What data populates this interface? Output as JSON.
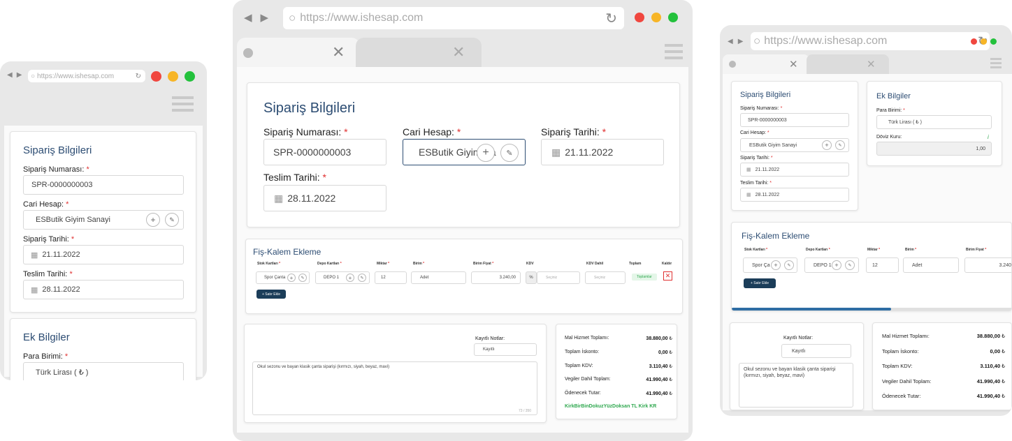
{
  "browser": {
    "url_full": "https://www.ishesap.com",
    "url_small": "https://www.ishesap.com",
    "close": "✕"
  },
  "siparis": {
    "title": "Sipariş Bilgileri",
    "no_label": "Sipariş Numarası:",
    "no_value": "SPR-0000000003",
    "cari_label": "Cari Hesap:",
    "cari_value_full": "ESButik Giyim Sanayi",
    "cari_value_trunc": "ESButik Giyim Sa",
    "tarih_label": "Sipariş Tarihi:",
    "tarih_value": "21.11.2022",
    "teslim_label": "Teslim Tarihi:",
    "teslim_value": "28.11.2022",
    "req": "*"
  },
  "ek": {
    "title": "Ek Bilgiler",
    "para_label": "Para Birimi:",
    "para_value": "Türk Lirası ( ₺ )",
    "doviz_label": "Döviz Kuru:",
    "doviz_value": "1,00",
    "info": "i"
  },
  "fis": {
    "title": "Fiş-Kalem Ekleme",
    "cols": {
      "stok": "Stok Kartları",
      "depo": "Depo Kartları",
      "miktar": "Miktar",
      "birim": "Birim",
      "fiyat": "Birim Fiyat",
      "kdv": "KDV",
      "kdvdahil": "KDV Dahil",
      "toplam": "Toplam",
      "kaldir": "Kaldır"
    },
    "row": {
      "stok": "Spor Çanta",
      "stok_short": "Spor Ça",
      "depo": "DEPO 1",
      "miktar": "12",
      "birim": "Adet",
      "fiyat": "3.240,00",
      "fiyat_short": "3.240",
      "kdv_pct": "%",
      "kdv_ph": "Seçiniz",
      "kdvdahil_ph": "Seçiniz",
      "toplam_badge": "Toplamlar"
    },
    "add_btn": "+ Satır Ekle"
  },
  "notes": {
    "label": "Kayıtlı Notlar:",
    "select": "Kayıtlı",
    "text": "Okul sezonu ve bayan klasik çanta siparişi (kırmızı, siyah, beyaz, mavi)",
    "counter": "73 / 350"
  },
  "summary": {
    "mal_label": "Mal Hizmet Toplamı:",
    "mal": "38.880,00",
    "isk_label": "Toplam İskonto:",
    "isk": "0,00",
    "kdv_label": "Toplam KDV:",
    "kdv": "3.110,40",
    "vdt_label": "Vegiler Dahil Toplam:",
    "vdt": "41.990,40",
    "odn_label": "Ödenecek Tutar:",
    "odn": "41.990,40",
    "currency": "₺",
    "words": "KirkBirBinDokuzYüzDoksan TL Kirk KR"
  },
  "colors": {
    "heading": "#2d4d73",
    "button": "#1b3d59",
    "required": "#e03030",
    "badge": "#2fa84f",
    "scroll": "#2e6da4"
  }
}
